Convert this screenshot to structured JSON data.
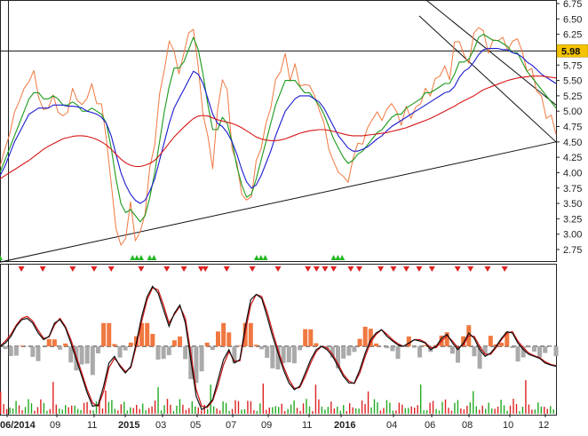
{
  "chart_data": [
    {
      "panel": "price",
      "type": "line",
      "ylim": [
        2.5,
        6.75
      ],
      "yticks": [
        "6.75",
        "6.50",
        "6.25",
        "6.00",
        "5.75",
        "5.50",
        "5.25",
        "5.00",
        "4.75",
        "4.50",
        "4.25",
        "4.00",
        "3.75",
        "3.50",
        "3.25",
        "3.00",
        "2.75"
      ],
      "last_price_label": "5.98",
      "last_price_value": 5.98,
      "colors": {
        "price": "#f07840",
        "ma_fast": "#1a9a1a",
        "ma_mid": "#1a1ad0",
        "ma_slow": "#d81818",
        "trend": "#111111",
        "buy": "#22b822",
        "sell": "#dd2222"
      },
      "x_index_range": [
        0,
        130
      ],
      "series": [
        {
          "role": "price",
          "values": [
            4.1,
            4.3,
            4.5,
            4.8,
            5.0,
            5.2,
            5.4,
            5.6,
            5.3,
            5.1,
            5.25,
            5.4,
            5.2,
            5.0,
            5.1,
            5.3,
            5.15,
            4.9,
            5.1,
            5.2,
            5.05,
            4.95,
            4.6,
            3.8,
            3.3,
            2.9,
            3.2,
            3.6,
            3.1,
            3.0,
            3.4,
            3.9,
            4.4,
            5.0,
            5.6,
            5.9,
            6.0,
            5.5,
            6.1,
            6.3,
            6.6,
            5.8,
            5.2,
            4.6,
            4.2,
            4.9,
            5.5,
            5.1,
            4.3,
            3.9,
            3.6,
            3.4,
            3.7,
            4.2,
            4.6,
            4.9,
            5.3,
            5.6,
            5.8,
            5.9,
            5.5,
            5.6,
            5.3,
            5.2,
            5.3,
            5.1,
            5.0,
            4.8,
            4.5,
            4.3,
            4.2,
            4.1,
            4.0,
            4.3,
            4.5,
            4.4,
            4.6,
            4.7,
            4.8,
            4.7,
            4.9,
            5.1,
            5.0,
            4.9,
            5.2,
            5.1,
            5.2,
            5.3,
            5.4,
            5.3,
            5.4,
            5.5,
            5.5,
            5.4,
            5.9,
            6.1,
            5.8,
            5.9,
            6.3,
            6.6,
            6.4,
            6.2,
            6.2,
            6.3,
            6.1,
            6.0,
            5.9,
            6.1,
            5.7,
            5.6,
            5.5,
            5.4,
            5.2,
            5.1,
            5.0,
            4.9
          ]
        },
        {
          "role": "ma_fast",
          "values": [
            4.0,
            4.2,
            4.4,
            4.6,
            4.8,
            5.0,
            5.2,
            5.3,
            5.3,
            5.2,
            5.2,
            5.25,
            5.2,
            5.1,
            5.1,
            5.15,
            5.1,
            5.0,
            5.0,
            5.05,
            5.0,
            4.95,
            4.8,
            4.4,
            3.9,
            3.5,
            3.35,
            3.4,
            3.3,
            3.2,
            3.3,
            3.6,
            4.0,
            4.5,
            5.0,
            5.4,
            5.7,
            5.7,
            5.8,
            6.0,
            6.2,
            6.0,
            5.6,
            5.1,
            4.7,
            4.7,
            4.9,
            4.8,
            4.5,
            4.1,
            3.8,
            3.6,
            3.65,
            3.9,
            4.2,
            4.5,
            4.8,
            5.1,
            5.3,
            5.5,
            5.5,
            5.5,
            5.4,
            5.3,
            5.3,
            5.2,
            5.1,
            4.95,
            4.75,
            4.55,
            4.4,
            4.25,
            4.15,
            4.2,
            4.3,
            4.35,
            4.45,
            4.55,
            4.65,
            4.7,
            4.8,
            4.9,
            4.95,
            4.95,
            5.05,
            5.1,
            5.15,
            5.2,
            5.3,
            5.3,
            5.35,
            5.4,
            5.45,
            5.45,
            5.6,
            5.8,
            5.8,
            5.85,
            6.0,
            6.2,
            6.25,
            6.2,
            6.15,
            6.15,
            6.1,
            6.05,
            5.95,
            5.95,
            5.8,
            5.65,
            5.55,
            5.45,
            5.35,
            5.25,
            5.15,
            5.05
          ]
        },
        {
          "role": "ma_mid",
          "values": [
            3.95,
            4.1,
            4.3,
            4.5,
            4.65,
            4.8,
            4.95,
            5.0,
            5.05,
            5.05,
            5.05,
            5.1,
            5.1,
            5.1,
            5.08,
            5.08,
            5.07,
            5.05,
            5.0,
            4.98,
            4.95,
            4.9,
            4.8,
            4.6,
            4.3,
            4.0,
            3.8,
            3.65,
            3.55,
            3.5,
            3.55,
            3.7,
            3.9,
            4.2,
            4.5,
            4.8,
            5.05,
            5.2,
            5.35,
            5.5,
            5.65,
            5.6,
            5.45,
            5.2,
            4.95,
            4.8,
            4.75,
            4.65,
            4.5,
            4.3,
            4.05,
            3.85,
            3.75,
            3.8,
            3.95,
            4.15,
            4.35,
            4.6,
            4.8,
            5.0,
            5.1,
            5.2,
            5.25,
            5.25,
            5.25,
            5.2,
            5.15,
            5.05,
            4.9,
            4.75,
            4.6,
            4.5,
            4.4,
            4.35,
            4.35,
            4.38,
            4.42,
            4.48,
            4.55,
            4.6,
            4.68,
            4.75,
            4.8,
            4.85,
            4.9,
            4.95,
            5.0,
            5.05,
            5.1,
            5.15,
            5.2,
            5.25,
            5.3,
            5.32,
            5.4,
            5.55,
            5.65,
            5.7,
            5.8,
            5.92,
            6.0,
            6.02,
            6.02,
            6.02,
            6.0,
            6.0,
            5.95,
            5.93,
            5.88,
            5.8,
            5.75,
            5.68,
            5.6,
            5.55,
            5.5,
            5.45
          ]
        },
        {
          "role": "ma_slow",
          "values": [
            3.9,
            3.95,
            4.0,
            4.05,
            4.1,
            4.15,
            4.2,
            4.26,
            4.32,
            4.38,
            4.43,
            4.47,
            4.51,
            4.55,
            4.57,
            4.59,
            4.6,
            4.6,
            4.59,
            4.57,
            4.54,
            4.5,
            4.45,
            4.38,
            4.3,
            4.22,
            4.16,
            4.12,
            4.1,
            4.1,
            4.12,
            4.15,
            4.2,
            4.28,
            4.38,
            4.48,
            4.58,
            4.66,
            4.74,
            4.81,
            4.88,
            4.92,
            4.93,
            4.92,
            4.89,
            4.86,
            4.84,
            4.82,
            4.8,
            4.77,
            4.73,
            4.68,
            4.63,
            4.58,
            4.55,
            4.53,
            4.52,
            4.52,
            4.53,
            4.55,
            4.58,
            4.61,
            4.64,
            4.66,
            4.68,
            4.69,
            4.7,
            4.7,
            4.69,
            4.67,
            4.65,
            4.63,
            4.61,
            4.6,
            4.6,
            4.6,
            4.61,
            4.62,
            4.63,
            4.64,
            4.65,
            4.67,
            4.69,
            4.71,
            4.73,
            4.76,
            4.79,
            4.82,
            4.85,
            4.88,
            4.92,
            4.96,
            5.0,
            5.04,
            5.08,
            5.13,
            5.17,
            5.21,
            5.25,
            5.3,
            5.35,
            5.38,
            5.41,
            5.44,
            5.47,
            5.5,
            5.52,
            5.54,
            5.55,
            5.56,
            5.57,
            5.57,
            5.57,
            5.56,
            5.55,
            5.54
          ]
        }
      ],
      "trendlines": [
        {
          "from": [
            -3,
            2.5
          ],
          "to": [
            130,
            4.5
          ]
        },
        {
          "from": [
            98,
            6.9
          ],
          "to": [
            130,
            5.1
          ]
        },
        {
          "from": [
            98,
            6.55
          ],
          "to": [
            130,
            4.5
          ]
        }
      ],
      "buy_signals": [
        0,
        31,
        32,
        33,
        35,
        36,
        60,
        61,
        62,
        78,
        79,
        80
      ],
      "sell_signals": [
        5,
        10,
        17,
        22,
        26,
        33,
        39,
        43,
        47,
        48,
        53,
        59,
        65,
        72,
        74,
        76,
        78,
        82,
        84,
        89,
        92,
        95,
        98,
        101,
        107,
        110,
        114,
        118
      ]
    },
    {
      "panel": "oscillator",
      "type": "line",
      "ylim": [
        -1,
        1
      ],
      "zero_line": 0,
      "colors": {
        "line_a": "#111111",
        "line_b": "#cc1111",
        "hist_pos": "#f07840",
        "hist_neg": "#aaaaaa",
        "vol_green": "#22aa22",
        "vol_red": "#dd2222"
      },
      "series": [
        {
          "role": "line_a",
          "values": [
            0.0,
            0.05,
            0.15,
            0.3,
            0.4,
            0.42,
            0.35,
            0.2,
            0.1,
            0.15,
            0.35,
            0.4,
            0.28,
            0.05,
            -0.2,
            -0.45,
            -0.7,
            -0.9,
            -0.88,
            -0.6,
            -0.25,
            -0.15,
            -0.3,
            -0.4,
            -0.3,
            0.05,
            0.45,
            0.75,
            0.9,
            0.8,
            0.55,
            0.3,
            0.5,
            0.62,
            0.35,
            -0.2,
            -0.75,
            -0.95,
            -0.9,
            -0.8,
            -0.5,
            -0.2,
            -0.05,
            -0.25,
            -0.2,
            0.3,
            0.7,
            0.78,
            0.72,
            0.45,
            0.15,
            -0.1,
            -0.35,
            -0.55,
            -0.65,
            -0.6,
            -0.4,
            -0.2,
            -0.05,
            0.0,
            -0.05,
            -0.15,
            -0.3,
            -0.45,
            -0.55,
            -0.55,
            -0.35,
            -0.1,
            0.1,
            0.2,
            0.25,
            0.15,
            0.08,
            0.02,
            0.0,
            0.05,
            0.1,
            0.08,
            0.05,
            -0.05,
            0.0,
            0.12,
            0.18,
            0.05,
            -0.05,
            0.05,
            0.2,
            0.12,
            -0.05,
            -0.15,
            -0.1,
            0.0,
            0.12,
            0.22,
            0.2,
            0.05,
            -0.05,
            -0.12,
            -0.15,
            -0.18,
            -0.25,
            -0.28,
            -0.3
          ]
        },
        {
          "role": "line_b",
          "values": [
            0.0,
            0.08,
            0.18,
            0.32,
            0.42,
            0.45,
            0.38,
            0.24,
            0.12,
            0.14,
            0.32,
            0.42,
            0.3,
            0.1,
            -0.15,
            -0.4,
            -0.65,
            -0.85,
            -0.9,
            -0.68,
            -0.32,
            -0.18,
            -0.28,
            -0.38,
            -0.32,
            0.0,
            0.38,
            0.7,
            0.88,
            0.85,
            0.62,
            0.35,
            0.48,
            0.6,
            0.42,
            -0.1,
            -0.65,
            -0.9,
            -0.92,
            -0.82,
            -0.58,
            -0.28,
            -0.08,
            -0.22,
            -0.22,
            0.22,
            0.62,
            0.78,
            0.75,
            0.52,
            0.22,
            -0.05,
            -0.3,
            -0.5,
            -0.63,
            -0.62,
            -0.45,
            -0.25,
            -0.08,
            0.0,
            -0.02,
            -0.12,
            -0.26,
            -0.42,
            -0.52,
            -0.56,
            -0.4,
            -0.15,
            0.06,
            0.18,
            0.25,
            0.18,
            0.1,
            0.04,
            0.0,
            0.04,
            0.1,
            0.1,
            0.06,
            -0.02,
            -0.02,
            0.08,
            0.16,
            0.08,
            -0.02,
            0.02,
            0.16,
            0.15,
            0.0,
            -0.12,
            -0.12,
            -0.02,
            0.1,
            0.2,
            0.22,
            0.08,
            -0.02,
            -0.1,
            -0.14,
            -0.17,
            -0.23,
            -0.27,
            -0.29
          ]
        }
      ]
    }
  ],
  "x_axis": {
    "labels": [
      {
        "text": "06/2014",
        "bold": true
      },
      {
        "text": "09",
        "bold": false
      },
      {
        "text": "11",
        "bold": false
      },
      {
        "text": "2015",
        "bold": true
      },
      {
        "text": "03",
        "bold": false
      },
      {
        "text": "05",
        "bold": false
      },
      {
        "text": "07",
        "bold": false
      },
      {
        "text": "09",
        "bold": false
      },
      {
        "text": "11",
        "bold": false
      },
      {
        "text": "2016",
        "bold": true
      },
      {
        "text": "04",
        "bold": false
      },
      {
        "text": "06",
        "bold": false
      },
      {
        "text": "08",
        "bold": false
      },
      {
        "text": "10",
        "bold": false
      },
      {
        "text": "12",
        "bold": false
      }
    ]
  }
}
